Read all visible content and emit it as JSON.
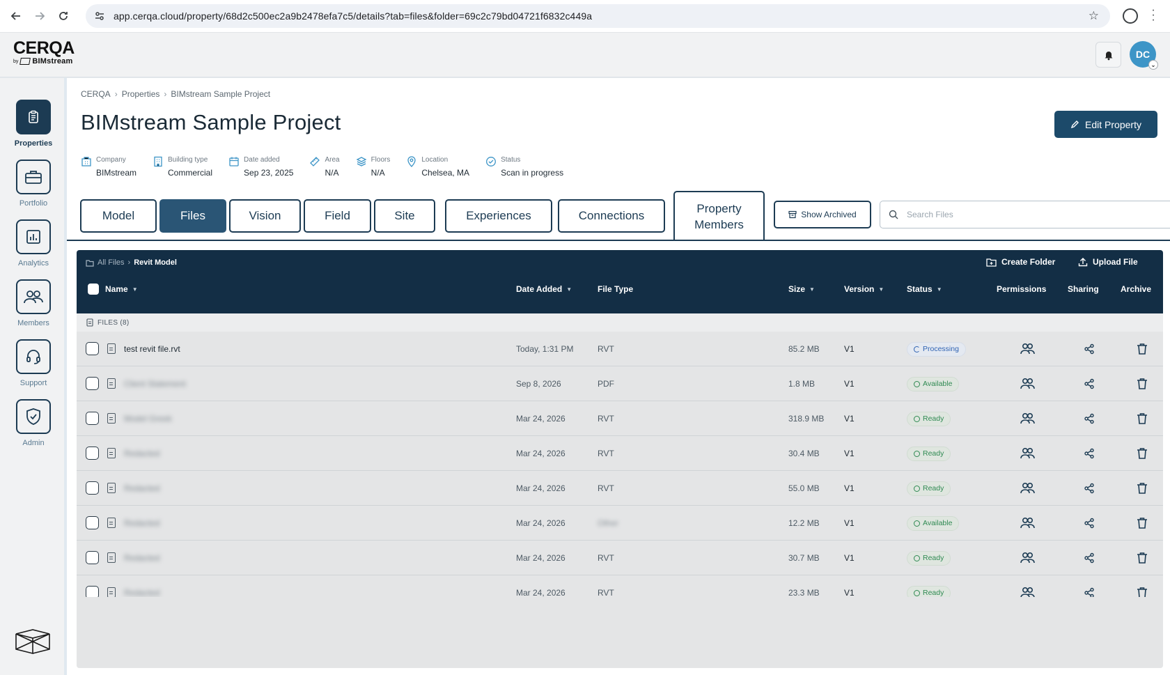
{
  "browser": {
    "url": "app.cerqa.cloud/property/68d2c500ec2a9b2478efa7c5/details?tab=files&folder=69c2c79bd04721f6832c449a"
  },
  "header": {
    "logo_main": "CERQA",
    "logo_by": "by",
    "logo_brand": "BIMstream",
    "avatar_initials": "DC"
  },
  "sidebar": {
    "items": [
      {
        "label": "Properties",
        "icon": "clipboard-icon",
        "active": true
      },
      {
        "label": "Portfolio",
        "icon": "briefcase-icon",
        "active": false
      },
      {
        "label": "Analytics",
        "icon": "chart-icon",
        "active": false
      },
      {
        "label": "Members",
        "icon": "users-icon",
        "active": false
      },
      {
        "label": "Support",
        "icon": "headset-icon",
        "active": false
      },
      {
        "label": "Admin",
        "icon": "shield-check-icon",
        "active": false
      }
    ]
  },
  "breadcrumb": [
    "CERQA",
    "Properties",
    "BIMstream Sample Project"
  ],
  "page_title": "BIMstream Sample Project",
  "edit_button": "Edit Property",
  "meta": [
    {
      "label": "Company",
      "value": "BIMstream",
      "icon": "building-icon"
    },
    {
      "label": "Building type",
      "value": "Commercial",
      "icon": "office-icon"
    },
    {
      "label": "Date added",
      "value": "Sep 23, 2025",
      "icon": "calendar-icon"
    },
    {
      "label": "Area",
      "value": "N/A",
      "icon": "ruler-icon"
    },
    {
      "label": "Floors",
      "value": "N/A",
      "icon": "layers-icon"
    },
    {
      "label": "Location",
      "value": "Chelsea, MA",
      "icon": "pin-icon"
    },
    {
      "label": "Status",
      "value": "Scan in progress",
      "icon": "check-circle-icon"
    }
  ],
  "tabs": [
    {
      "label": "Model"
    },
    {
      "label": "Files"
    },
    {
      "label": "Vision"
    },
    {
      "label": "Field"
    },
    {
      "label": "Site"
    },
    {
      "label": "Experiences"
    },
    {
      "label": "Connections"
    },
    {
      "label": "Property Members"
    }
  ],
  "active_tab": "Files",
  "show_archived": "Show Archived",
  "search": {
    "placeholder": "Search Files",
    "value": ""
  },
  "files": {
    "crumb_root": "All Files",
    "crumb_current": "Revit Model",
    "create_folder": "Create Folder",
    "upload_file": "Upload File",
    "columns": {
      "name": "Name",
      "date_added": "Date Added",
      "file_type": "File Type",
      "size": "Size",
      "version": "Version",
      "status": "Status",
      "permissions": "Permissions",
      "sharing": "Sharing",
      "archive": "Archive"
    },
    "group_label": "FILES (8)",
    "rows": [
      {
        "name": "test revit file.rvt",
        "name_blurred": false,
        "date": "Today, 1:31 PM",
        "type": "RVT",
        "type_blurred": false,
        "size": "85.2 MB",
        "version": "V1",
        "status": "Processing",
        "status_kind": "processing"
      },
      {
        "name": "Client Statement",
        "name_blurred": true,
        "date": "Sep 8, 2026",
        "type": "PDF",
        "type_blurred": false,
        "size": "1.8 MB",
        "version": "V1",
        "status": "Available",
        "status_kind": "available"
      },
      {
        "name": "Model Greek",
        "name_blurred": true,
        "date": "Mar 24, 2026",
        "type": "RVT",
        "type_blurred": false,
        "size": "318.9 MB",
        "version": "V1",
        "status": "Ready",
        "status_kind": "ready"
      },
      {
        "name": "Redacted",
        "name_blurred": true,
        "date": "Mar 24, 2026",
        "type": "RVT",
        "type_blurred": false,
        "size": "30.4 MB",
        "version": "V1",
        "status": "Ready",
        "status_kind": "ready"
      },
      {
        "name": "Redacted",
        "name_blurred": true,
        "date": "Mar 24, 2026",
        "type": "RVT",
        "type_blurred": false,
        "size": "55.0 MB",
        "version": "V1",
        "status": "Ready",
        "status_kind": "ready"
      },
      {
        "name": "Redacted",
        "name_blurred": true,
        "date": "Mar 24, 2026",
        "type": "Other",
        "type_blurred": true,
        "size": "12.2 MB",
        "version": "V1",
        "status": "Available",
        "status_kind": "available"
      },
      {
        "name": "Redacted",
        "name_blurred": true,
        "date": "Mar 24, 2026",
        "type": "RVT",
        "type_blurred": false,
        "size": "30.7 MB",
        "version": "V1",
        "status": "Ready",
        "status_kind": "ready"
      },
      {
        "name": "Redacted",
        "name_blurred": true,
        "date": "Mar 24, 2026",
        "type": "RVT",
        "type_blurred": false,
        "size": "23.3 MB",
        "version": "V1",
        "status": "Ready",
        "status_kind": "ready"
      }
    ]
  },
  "colors": {
    "navy": "#132e45",
    "accent": "#2a5575",
    "link_blue": "#3d95c7",
    "ready_green": "#2f8a52",
    "processing_blue": "#2f63b3"
  }
}
